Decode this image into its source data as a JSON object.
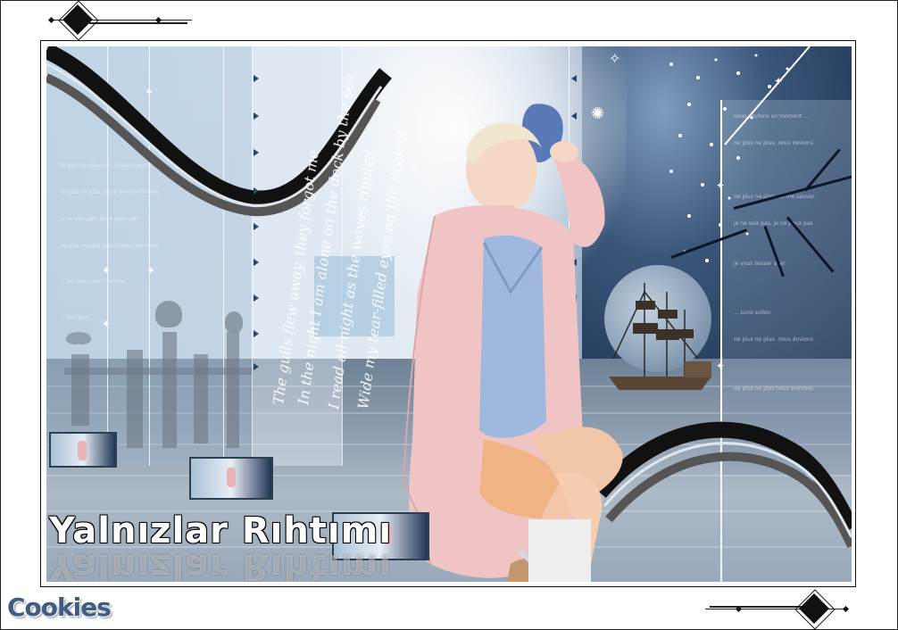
{
  "artwork": {
    "title": "Yalnızlar Rıhtımı",
    "poem_lines": [
      "The gulls flew away, they forgot me",
      "In the night I am alone on the dock by the sea",
      "I read all night as the waves rippled",
      "Wide my tear-filled eyes on the dock at"
    ],
    "signature": "Cookies"
  },
  "colors": {
    "frame": "#111111",
    "sky_dark": "#1f3556",
    "sky_light": "#c9dcec",
    "coat_pink": "#f0c4c5",
    "sweater_blue": "#9fb8de",
    "signature_blue": "#3f5c84"
  },
  "icons": [
    "diamond-ornament-top-left",
    "diamond-ornament-bottom-right",
    "sparkle-icon",
    "arrow-marker-icon"
  ]
}
